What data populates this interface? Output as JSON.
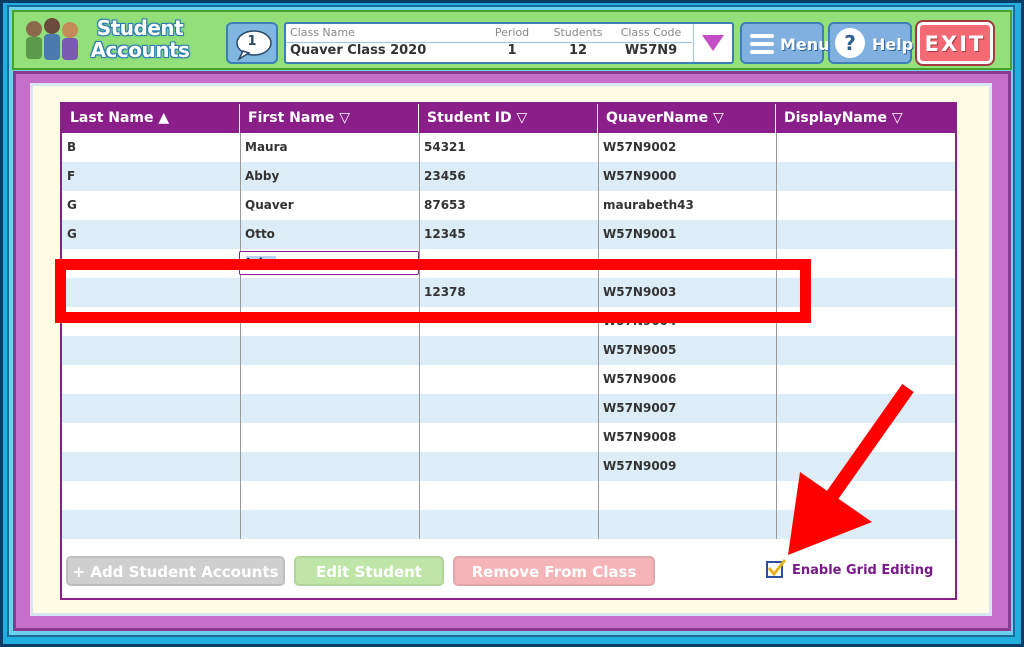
{
  "logo": {
    "line1": "Student",
    "line2": "Accounts"
  },
  "chat": {
    "count": "1"
  },
  "class_panel": {
    "class_name_label": "Class Name",
    "class_name": "Quaver Class 2020",
    "period_label": "Period",
    "period": "1",
    "students_label": "Students",
    "students": "12",
    "class_code_label": "Class Code",
    "class_code": "W57N9"
  },
  "header_buttons": {
    "menu": "Menu",
    "help": "Help",
    "exit": "EXIT"
  },
  "table": {
    "columns": [
      "Last Name ▲",
      "First Name ▽",
      "Student ID ▽",
      "QuaverName ▽",
      "DisplayName ▽"
    ],
    "rows": [
      [
        "B",
        "Maura",
        "54321",
        "W57N9002",
        ""
      ],
      [
        "F",
        "Abby",
        "23456",
        "W57N9000",
        ""
      ],
      [
        "G",
        "Quaver",
        "87653",
        "maurabeth43",
        ""
      ],
      [
        "G",
        "Otto",
        "12345",
        "W57N9001",
        ""
      ],
      [
        "",
        "",
        "",
        "",
        ""
      ],
      [
        "",
        "",
        "12378",
        "W57N9003",
        ""
      ],
      [
        "",
        "",
        "",
        "W57N9004",
        ""
      ],
      [
        "",
        "",
        "",
        "W57N9005",
        ""
      ],
      [
        "",
        "",
        "",
        "W57N9006",
        ""
      ],
      [
        "",
        "",
        "",
        "W57N9007",
        ""
      ],
      [
        "",
        "",
        "",
        "W57N9008",
        ""
      ],
      [
        "",
        "",
        "",
        "W57N9009",
        ""
      ],
      [
        "",
        "",
        "",
        "",
        ""
      ],
      [
        "",
        "",
        "",
        "",
        ""
      ]
    ],
    "editing_value": "John"
  },
  "footer": {
    "add_students": "+ Add Student Accounts",
    "edit_student": "Edit Student",
    "remove_from_class": "Remove From Class",
    "grid_editing_label": "Enable Grid Editing",
    "grid_editing_checked": true
  },
  "colors": {
    "header_green": "#93e07a",
    "frame_purple": "#c56fca",
    "table_header": "#8a1f8a",
    "row_alt": "#dcedf8",
    "annotation_red": "#ff0000"
  }
}
